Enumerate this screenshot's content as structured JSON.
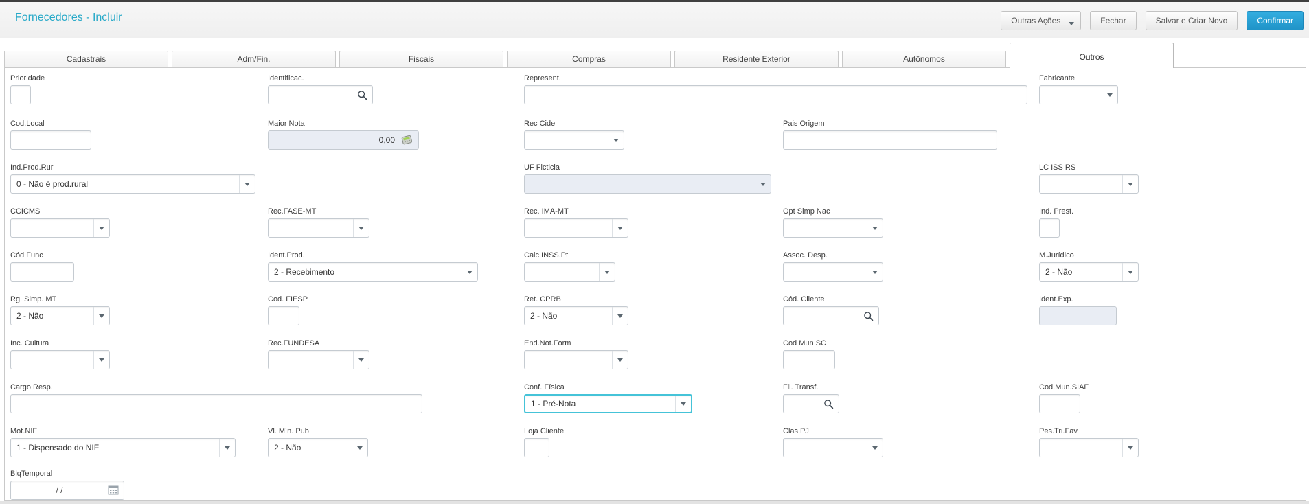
{
  "header": {
    "title": "Fornecedores - Incluir",
    "buttons": {
      "outras_acoes": "Outras Ações",
      "fechar": "Fechar",
      "salvar_criar": "Salvar e Criar Novo",
      "confirmar": "Confirmar"
    }
  },
  "colors": {
    "title_accent": "#27a9c8",
    "primary_button": "#2aa3d6",
    "focus_border": "#45c3d8",
    "disabled_bg": "#e9edf4"
  },
  "tabs": [
    {
      "label": "Cadastrais",
      "active": false
    },
    {
      "label": "Adm/Fin.",
      "active": false
    },
    {
      "label": "Fiscais",
      "active": false
    },
    {
      "label": "Compras",
      "active": false
    },
    {
      "label": "Residente Exterior",
      "active": false
    },
    {
      "label": "Autônomos",
      "active": false
    },
    {
      "label": "Outros",
      "active": true
    }
  ],
  "fields": [
    {
      "id": "prioridade",
      "label": "Prioridade",
      "type": "text",
      "value": "",
      "state": ""
    },
    {
      "id": "identificac",
      "label": "Identificac.",
      "type": "search",
      "value": "",
      "state": ""
    },
    {
      "id": "represent",
      "label": "Represent.",
      "type": "text",
      "value": "",
      "state": ""
    },
    {
      "id": "fabricante",
      "label": "Fabricante",
      "type": "select",
      "value": "",
      "state": ""
    },
    {
      "id": "cod_local",
      "label": "Cod.Local",
      "type": "text",
      "value": "",
      "state": ""
    },
    {
      "id": "maior_nota",
      "label": "Maior Nota",
      "type": "money",
      "value": "0,00",
      "state": "disabled"
    },
    {
      "id": "rec_cide",
      "label": "Rec Cide",
      "type": "select",
      "value": "",
      "state": ""
    },
    {
      "id": "pais_origem",
      "label": "Pais Origem",
      "type": "text",
      "value": "",
      "state": ""
    },
    {
      "id": "ind_prod_rur",
      "label": "Ind.Prod.Rur",
      "type": "select",
      "value": "0 - Não é prod.rural",
      "state": ""
    },
    {
      "id": "uf_ficticia",
      "label": "UF Ficticia",
      "type": "select",
      "value": "",
      "state": "disabled"
    },
    {
      "id": "lc_iss_rs",
      "label": "LC ISS RS",
      "type": "select",
      "value": "",
      "state": ""
    },
    {
      "id": "ccicms",
      "label": "CCICMS",
      "type": "select",
      "value": "",
      "state": ""
    },
    {
      "id": "rec_fase_mt",
      "label": "Rec.FASE-MT",
      "type": "select",
      "value": "",
      "state": ""
    },
    {
      "id": "rec_ima_mt",
      "label": "Rec. IMA-MT",
      "type": "select",
      "value": "",
      "state": ""
    },
    {
      "id": "opt_simp_nac",
      "label": "Opt Simp Nac",
      "type": "select",
      "value": "",
      "state": ""
    },
    {
      "id": "ind_prest",
      "label": "Ind. Prest.",
      "type": "text",
      "value": "",
      "state": ""
    },
    {
      "id": "cod_func",
      "label": "Cód Func",
      "type": "text",
      "value": "",
      "state": ""
    },
    {
      "id": "ident_prod",
      "label": "Ident.Prod.",
      "type": "select",
      "value": "2 - Recebimento",
      "state": ""
    },
    {
      "id": "calc_inss_pt",
      "label": "Calc.INSS.Pt",
      "type": "select",
      "value": "",
      "state": ""
    },
    {
      "id": "assoc_desp",
      "label": "Assoc. Desp.",
      "type": "select",
      "value": "",
      "state": ""
    },
    {
      "id": "m_juridico",
      "label": "M.Jurídico",
      "type": "select",
      "value": "2 - Não",
      "state": ""
    },
    {
      "id": "rg_simp_mt",
      "label": "Rg. Simp. MT",
      "type": "select",
      "value": "2 - Não",
      "state": ""
    },
    {
      "id": "cod_fiesp",
      "label": "Cod. FIESP",
      "type": "text",
      "value": "",
      "state": ""
    },
    {
      "id": "ret_cprb",
      "label": "Ret. CPRB",
      "type": "select",
      "value": "2 - Não",
      "state": ""
    },
    {
      "id": "cod_cliente",
      "label": "Cód. Cliente",
      "type": "search",
      "value": "",
      "state": ""
    },
    {
      "id": "ident_exp",
      "label": "Ident.Exp.",
      "type": "text",
      "value": "",
      "state": "disabled"
    },
    {
      "id": "inc_cultura",
      "label": "Inc. Cultura",
      "type": "select",
      "value": "",
      "state": ""
    },
    {
      "id": "rec_fundesa",
      "label": "Rec.FUNDESA",
      "type": "select",
      "value": "",
      "state": ""
    },
    {
      "id": "end_not_form",
      "label": "End.Not.Form",
      "type": "select",
      "value": "",
      "state": ""
    },
    {
      "id": "cod_mun_sc",
      "label": "Cod Mun SC",
      "type": "text",
      "value": "",
      "state": ""
    },
    {
      "id": "cargo_resp",
      "label": "Cargo Resp.",
      "type": "text",
      "value": "",
      "state": ""
    },
    {
      "id": "conf_fisica",
      "label": "Conf. Física",
      "type": "select",
      "value": "1 - Pré-Nota",
      "state": "focused"
    },
    {
      "id": "fil_transf",
      "label": "Fil. Transf.",
      "type": "search",
      "value": "",
      "state": ""
    },
    {
      "id": "cod_mun_siaf",
      "label": "Cod.Mun.SIAF",
      "type": "text",
      "value": "",
      "state": ""
    },
    {
      "id": "mot_nif",
      "label": "Mot.NIF",
      "type": "select",
      "value": "1 - Dispensado do NIF",
      "state": ""
    },
    {
      "id": "vl_min_pub",
      "label": "Vl. Mín. Pub",
      "type": "select",
      "value": "2 - Não",
      "state": ""
    },
    {
      "id": "loja_cliente",
      "label": "Loja Cliente",
      "type": "text",
      "value": "",
      "state": ""
    },
    {
      "id": "clas_pj",
      "label": "Clas.PJ",
      "type": "select",
      "value": "",
      "state": ""
    },
    {
      "id": "pes_tri_fav",
      "label": "Pes.Tri.Fav.",
      "type": "select",
      "value": "",
      "state": ""
    },
    {
      "id": "blq_temporal",
      "label": "BlqTemporal",
      "type": "date",
      "value": "/ /",
      "state": ""
    }
  ]
}
